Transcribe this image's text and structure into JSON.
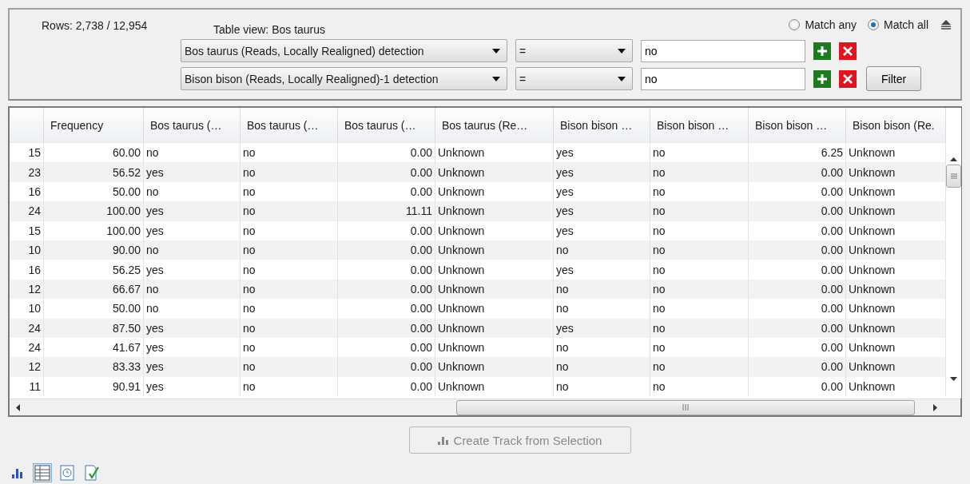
{
  "filter_panel": {
    "rows_count": "Rows: 2,738 / 12,954",
    "table_view": "Table view: Bos taurus",
    "match_options": [
      {
        "label": "Match any",
        "selected": false
      },
      {
        "label": "Match all",
        "selected": true
      }
    ],
    "filters": [
      {
        "field": "Bos taurus (Reads, Locally Realigned) detection",
        "operator": "=",
        "value": "no"
      },
      {
        "field": "Bison bison (Reads, Locally Realigned)-1 detection",
        "operator": "=",
        "value": "no"
      }
    ],
    "filter_button": "Filter"
  },
  "table": {
    "columns": [
      {
        "kind": "number"
      },
      {
        "label": "Frequency",
        "kind": "number"
      },
      {
        "label": "Bos taurus (…",
        "kind": "text"
      },
      {
        "label": "Bos taurus (…",
        "kind": "text"
      },
      {
        "label": "Bos taurus (…",
        "kind": "number"
      },
      {
        "label": "Bos taurus (Re…",
        "kind": "text"
      },
      {
        "label": "Bison bison …",
        "kind": "text"
      },
      {
        "label": "Bison bison …",
        "kind": "text"
      },
      {
        "label": "Bison bison …",
        "kind": "number"
      },
      {
        "label": "Bison bison (Re.",
        "kind": "text"
      }
    ],
    "rows": [
      [
        "15",
        "60.00",
        "no",
        "no",
        "0.00",
        "Unknown",
        "yes",
        "no",
        "6.25",
        "Unknown"
      ],
      [
        "23",
        "56.52",
        "yes",
        "no",
        "0.00",
        "Unknown",
        "yes",
        "no",
        "0.00",
        "Unknown"
      ],
      [
        "16",
        "50.00",
        "no",
        "no",
        "0.00",
        "Unknown",
        "yes",
        "no",
        "0.00",
        "Unknown"
      ],
      [
        "24",
        "100.00",
        "yes",
        "no",
        "11.11",
        "Unknown",
        "yes",
        "no",
        "0.00",
        "Unknown"
      ],
      [
        "15",
        "100.00",
        "yes",
        "no",
        "0.00",
        "Unknown",
        "yes",
        "no",
        "0.00",
        "Unknown"
      ],
      [
        "10",
        "90.00",
        "no",
        "no",
        "0.00",
        "Unknown",
        "no",
        "no",
        "0.00",
        "Unknown"
      ],
      [
        "16",
        "56.25",
        "yes",
        "no",
        "0.00",
        "Unknown",
        "yes",
        "no",
        "0.00",
        "Unknown"
      ],
      [
        "12",
        "66.67",
        "no",
        "no",
        "0.00",
        "Unknown",
        "no",
        "no",
        "0.00",
        "Unknown"
      ],
      [
        "10",
        "50.00",
        "no",
        "no",
        "0.00",
        "Unknown",
        "no",
        "no",
        "0.00",
        "Unknown"
      ],
      [
        "24",
        "87.50",
        "yes",
        "no",
        "0.00",
        "Unknown",
        "yes",
        "no",
        "0.00",
        "Unknown"
      ],
      [
        "24",
        "41.67",
        "yes",
        "no",
        "0.00",
        "Unknown",
        "no",
        "no",
        "0.00",
        "Unknown"
      ],
      [
        "12",
        "83.33",
        "yes",
        "no",
        "0.00",
        "Unknown",
        "no",
        "no",
        "0.00",
        "Unknown"
      ],
      [
        "11",
        "90.91",
        "yes",
        "no",
        "0.00",
        "Unknown",
        "no",
        "no",
        "0.00",
        "Unknown"
      ]
    ]
  },
  "create_track_button": {
    "label": "Create Track from Selection",
    "disabled": true
  },
  "view_tabs": [
    {
      "kind": "chart",
      "selected": false
    },
    {
      "kind": "table",
      "selected": true
    },
    {
      "kind": "history",
      "selected": false
    },
    {
      "kind": "validate",
      "selected": false
    }
  ]
}
